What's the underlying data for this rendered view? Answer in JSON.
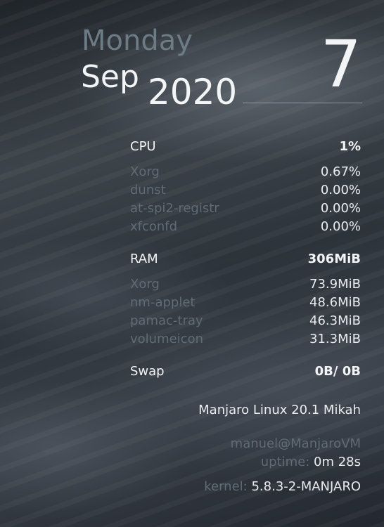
{
  "date": {
    "weekday": "Monday",
    "month": "Sep",
    "year": "2020",
    "day": "7"
  },
  "cpu": {
    "label": "CPU",
    "total": "1%",
    "processes": [
      {
        "name": "Xorg",
        "value": "0.67%"
      },
      {
        "name": "dunst",
        "value": "0.00%"
      },
      {
        "name": "at-spi2-registr",
        "value": "0.00%"
      },
      {
        "name": "xfconfd",
        "value": "0.00%"
      }
    ]
  },
  "ram": {
    "label": "RAM",
    "total": "306MiB",
    "processes": [
      {
        "name": "Xorg",
        "value": "73.9MiB"
      },
      {
        "name": "nm-applet",
        "value": "48.6MiB"
      },
      {
        "name": "pamac-tray",
        "value": "46.3MiB"
      },
      {
        "name": "volumeicon",
        "value": "31.3MiB"
      }
    ]
  },
  "swap": {
    "label": "Swap",
    "value": "0B/ 0B"
  },
  "system": {
    "distro": "Manjaro Linux 20.1 Mikah",
    "user_host": "manuel@ManjaroVM",
    "uptime_label": "uptime:",
    "uptime_value": "0m 28s",
    "kernel_label": "kernel:",
    "kernel_value": "5.8.3-2-MANJARO"
  }
}
